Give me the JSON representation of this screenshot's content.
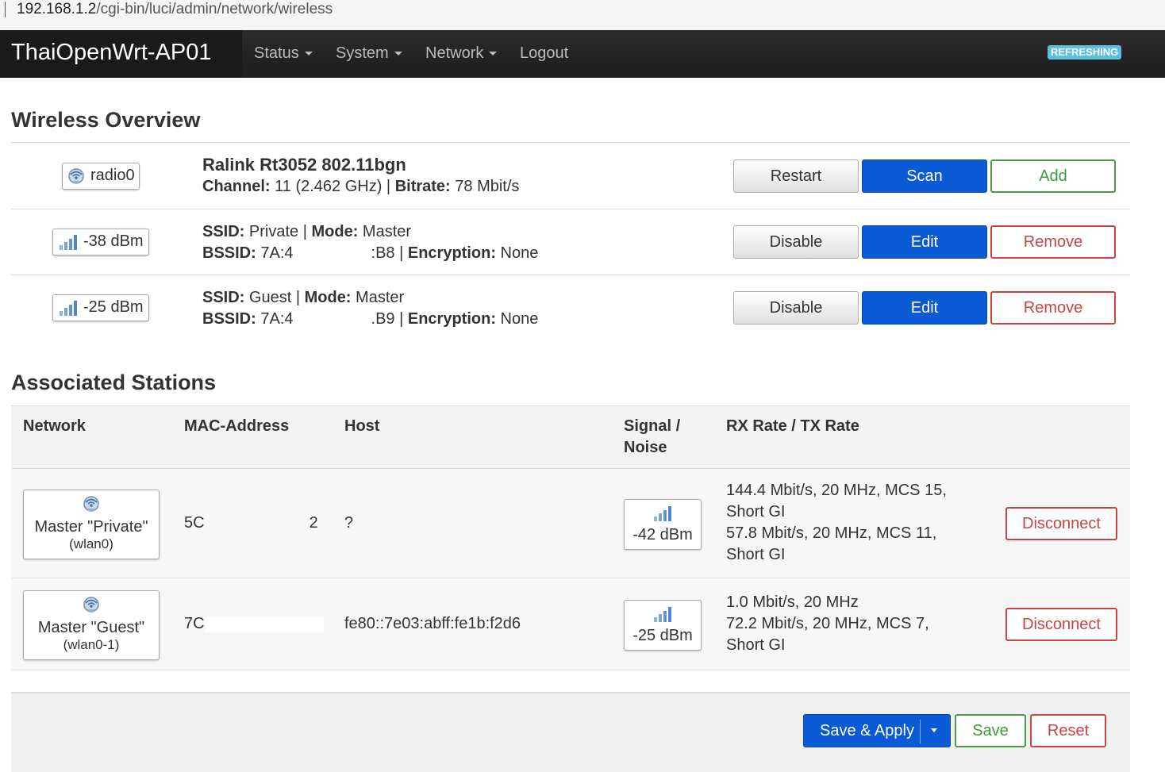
{
  "browser": {
    "url_host": "192.168.1.2",
    "url_path": "/cgi-bin/luci/admin/network/wireless"
  },
  "navbar": {
    "brand": "ThaiOpenWrt-AP01",
    "items": [
      "Status",
      "System",
      "Network",
      "Logout"
    ],
    "badge": "REFRESHING"
  },
  "overview": {
    "title": "Wireless Overview",
    "radio": {
      "badge": "radio0",
      "name": "Ralink Rt3052 802.11bgn",
      "channel_label": "Channel:",
      "channel_value": "11 (2.462 GHz) |",
      "bitrate_label": "Bitrate:",
      "bitrate_value": "78 Mbit/s",
      "buttons": {
        "restart": "Restart",
        "scan": "Scan",
        "add": "Add"
      }
    },
    "networks": [
      {
        "signal": "-38 dBm",
        "ssid_label": "SSID:",
        "ssid_value": "Private |",
        "mode_label": "Mode:",
        "mode_value": "Master",
        "bssid_label": "BSSID:",
        "bssid_prefix": "7A:4",
        "bssid_suffix": ":B8 |",
        "enc_label": "Encryption:",
        "enc_value": "None",
        "buttons": {
          "disable": "Disable",
          "edit": "Edit",
          "remove": "Remove"
        }
      },
      {
        "signal": "-25 dBm",
        "ssid_label": "SSID:",
        "ssid_value": "Guest |",
        "mode_label": "Mode:",
        "mode_value": "Master",
        "bssid_label": "BSSID:",
        "bssid_prefix": "7A:4",
        "bssid_suffix": ".B9 |",
        "enc_label": "Encryption:",
        "enc_value": "None",
        "buttons": {
          "disable": "Disable",
          "edit": "Edit",
          "remove": "Remove"
        }
      }
    ]
  },
  "stations": {
    "title": "Associated Stations",
    "headers": {
      "network": "Network",
      "mac": "MAC-Address",
      "host": "Host",
      "signal_1": "Signal /",
      "signal_2": "Noise",
      "rate": "RX Rate / TX Rate"
    },
    "rows": [
      {
        "net_name": "Master \"Private\"",
        "net_iface": "(wlan0)",
        "mac_prefix": "5C",
        "mac_suffix": "2",
        "host": "?",
        "signal": "-42 dBm",
        "rate_lines": [
          "144.4 Mbit/s, 20 MHz, MCS 15,",
          "Short GI",
          "57.8 Mbit/s, 20 MHz, MCS 11,",
          "Short GI"
        ],
        "action": "Disconnect"
      },
      {
        "net_name": "Master \"Guest\"",
        "net_iface": "(wlan0-1)",
        "mac_prefix": "7C",
        "mac_suffix": "",
        "host": "fe80::7e03:abff:fe1b:f2d6",
        "signal": "-25 dBm",
        "rate_lines": [
          "1.0 Mbit/s, 20 MHz",
          "72.2 Mbit/s, 20 MHz, MCS 7,",
          "Short GI"
        ],
        "action": "Disconnect"
      }
    ]
  },
  "footer": {
    "save_apply": "Save & Apply",
    "save": "Save",
    "reset": "Reset"
  },
  "colors": {
    "primary": "#0a5ad6",
    "success": "#3c9a3c",
    "danger": "#c94444",
    "badge": "#5bc0de",
    "navbar": "#222222"
  }
}
